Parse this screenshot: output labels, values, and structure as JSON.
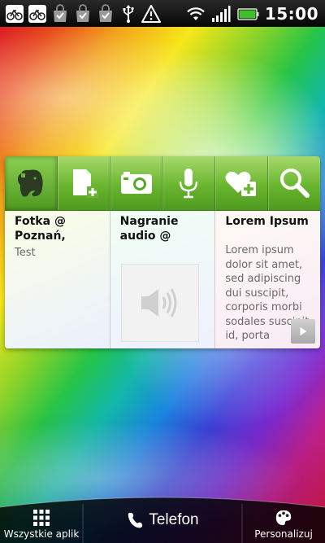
{
  "status_bar": {
    "time": "15:00",
    "icons": [
      "bike-notification-icon",
      "bike-notification-icon",
      "shopping-bag-check-icon",
      "shopping-bag-check-icon",
      "shopping-bag-check-icon",
      "usb-icon",
      "warning-icon",
      "wifi-icon",
      "signal-icon",
      "battery-icon"
    ],
    "battery_color": "#3fbf2a"
  },
  "widget": {
    "toolbar": [
      "evernote-elephant-icon",
      "new-note-icon",
      "camera-icon",
      "microphone-icon",
      "new-favorite-icon",
      "search-icon"
    ],
    "accent": "#6ab52f",
    "notes": [
      {
        "title": "Fotka @ Poznań,",
        "subtitle": "Test"
      },
      {
        "title": "Nagranie audio @",
        "thumbnail": "speaker-icon"
      },
      {
        "title": "Lorem Ipsum",
        "body": "Lorem ipsum dolor sit amet, sed adipiscing dui suscipit, corporis morbi sodales suscipit id, porta"
      }
    ]
  },
  "dock": {
    "all_apps": "Wszystkie aplik",
    "phone": "Telefon",
    "personalize": "Personalizuj"
  }
}
